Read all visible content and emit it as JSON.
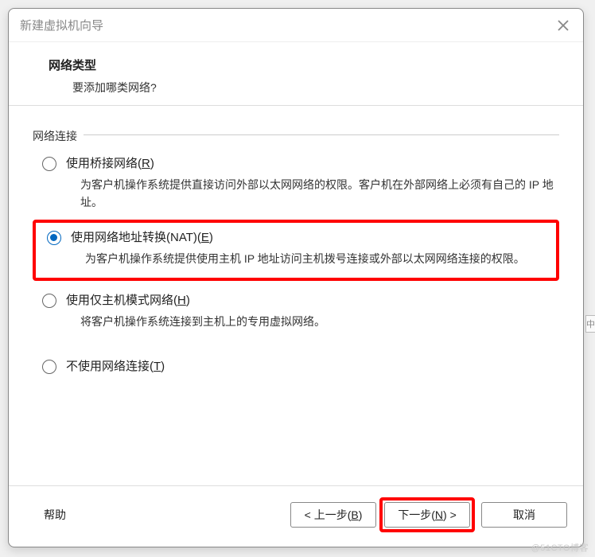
{
  "dialog": {
    "title": "新建虚拟机向导"
  },
  "header": {
    "title": "网络类型",
    "subtitle": "要添加哪类网络?"
  },
  "fieldset": {
    "legend": "网络连接"
  },
  "options": {
    "bridged": {
      "label_pre": "使用桥接网络(",
      "label_ul": "R",
      "label_post": ")",
      "desc": "为客户机操作系统提供直接访问外部以太网网络的权限。客户机在外部网络上必须有自己的 IP 地址。",
      "checked": false
    },
    "nat": {
      "label_pre": "使用网络地址转换(NAT)(",
      "label_ul": "E",
      "label_post": ")",
      "desc": "为客户机操作系统提供使用主机 IP 地址访问主机拨号连接或外部以太网网络连接的权限。",
      "checked": true
    },
    "hostonly": {
      "label_pre": "使用仅主机模式网络(",
      "label_ul": "H",
      "label_post": ")",
      "desc": "将客户机操作系统连接到主机上的专用虚拟网络。",
      "checked": false
    },
    "none": {
      "label_pre": "不使用网络连接(",
      "label_ul": "T",
      "label_post": ")",
      "desc": "",
      "checked": false
    }
  },
  "footer": {
    "help": "帮助",
    "back_pre": "< 上一步(",
    "back_ul": "B",
    "back_post": ")",
    "next_pre": "下一步(",
    "next_ul": "N",
    "next_post": ") >",
    "cancel": "取消"
  },
  "watermark": "@51CTO博客"
}
